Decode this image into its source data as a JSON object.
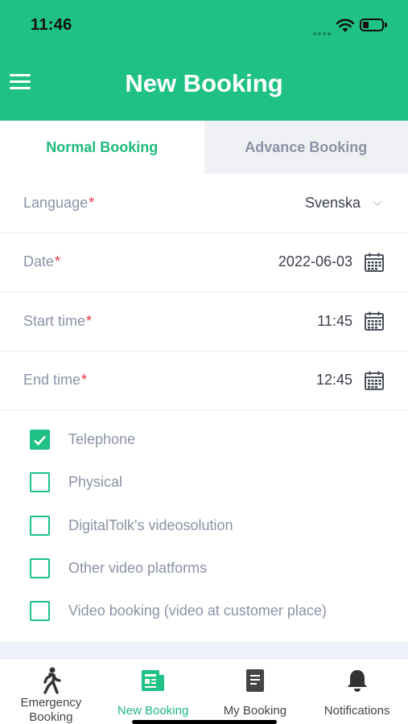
{
  "status_bar": {
    "time": "11:46"
  },
  "header": {
    "title": "New Booking"
  },
  "tabs": [
    {
      "label": "Normal Booking",
      "active": true
    },
    {
      "label": "Advance Booking",
      "active": false
    }
  ],
  "form": {
    "language": {
      "label": "Language",
      "required_mark": "*",
      "value": "Svenska"
    },
    "date": {
      "label": "Date",
      "required_mark": "*",
      "value": "2022-06-03"
    },
    "start_time": {
      "label": "Start time",
      "required_mark": "*",
      "value": "11:45"
    },
    "end_time": {
      "label": "End time",
      "required_mark": "*",
      "value": "12:45"
    }
  },
  "booking_types": [
    {
      "label": "Telephone",
      "checked": true
    },
    {
      "label": "Physical",
      "checked": false
    },
    {
      "label": "DigitalTolk's videosolution",
      "checked": false
    },
    {
      "label": "Other video platforms",
      "checked": false
    },
    {
      "label": "Video booking (video at customer place)",
      "checked": false
    }
  ],
  "tabbar": {
    "items": [
      {
        "label": "Emergency Booking",
        "icon": "walking-person-icon",
        "active": false
      },
      {
        "label": "New Booking",
        "icon": "new-booking-icon",
        "active": true
      },
      {
        "label": "My Booking",
        "icon": "document-icon",
        "active": false
      },
      {
        "label": "Notifications",
        "icon": "bell-icon",
        "active": false
      }
    ]
  },
  "colors": {
    "brand": "#1fc185",
    "required": "#e8324a",
    "label": "#8a93a5"
  }
}
